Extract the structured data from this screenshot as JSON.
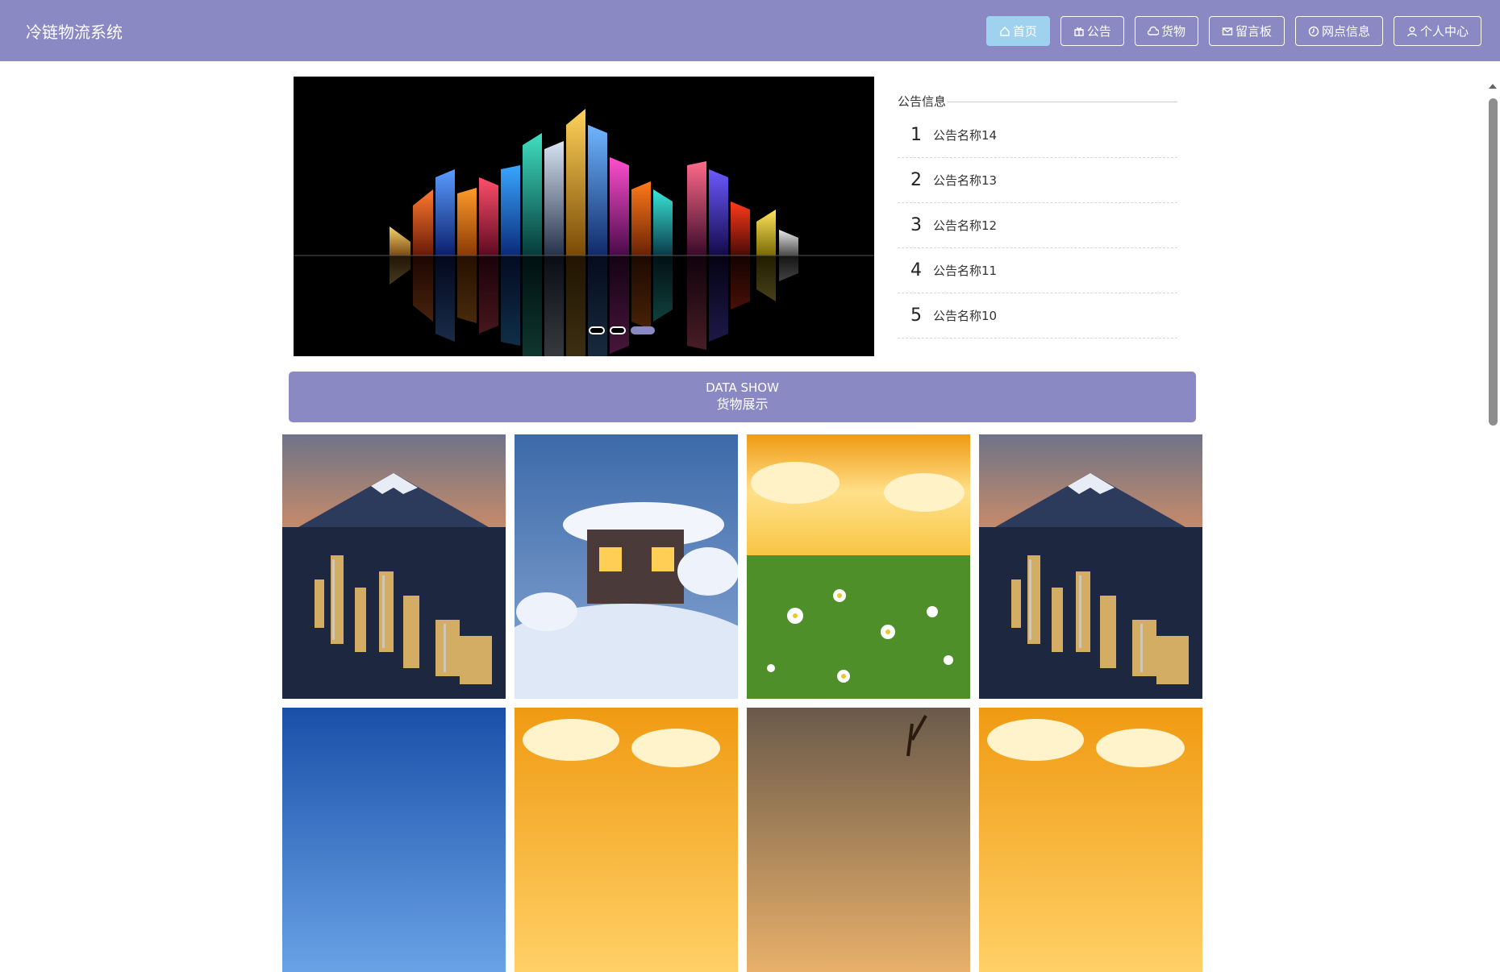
{
  "header": {
    "title": "冷链物流系统",
    "nav": [
      {
        "label": "首页",
        "icon": "home-icon",
        "active": true
      },
      {
        "label": "公告",
        "icon": "gift-icon",
        "active": false
      },
      {
        "label": "货物",
        "icon": "cloud-icon",
        "active": false
      },
      {
        "label": "留言板",
        "icon": "mail-icon",
        "active": false
      },
      {
        "label": "网点信息",
        "icon": "clock-icon",
        "active": false
      },
      {
        "label": "个人中心",
        "icon": "user-icon",
        "active": false
      }
    ]
  },
  "carousel": {
    "active_index": 2,
    "slide_count": 3
  },
  "notice": {
    "title": "公告信息",
    "items": [
      {
        "num": "1",
        "text": "公告名称14"
      },
      {
        "num": "2",
        "text": "公告名称13"
      },
      {
        "num": "3",
        "text": "公告名称12"
      },
      {
        "num": "4",
        "text": "公告名称11"
      },
      {
        "num": "5",
        "text": "公告名称10"
      }
    ]
  },
  "section": {
    "en": "DATA SHOW",
    "zh": "货物展示"
  },
  "gallery": {
    "tiles": [
      {
        "image": "city-mountain"
      },
      {
        "image": "snow-house"
      },
      {
        "image": "daisy-field"
      },
      {
        "image": "city-mountain"
      },
      {
        "image": "blue-sky"
      },
      {
        "image": "orange-clouds"
      },
      {
        "image": "sunset-tree"
      },
      {
        "image": "orange-clouds"
      }
    ]
  },
  "colors": {
    "brand": "#8a89c4",
    "active_nav": "#9ed2ee"
  }
}
